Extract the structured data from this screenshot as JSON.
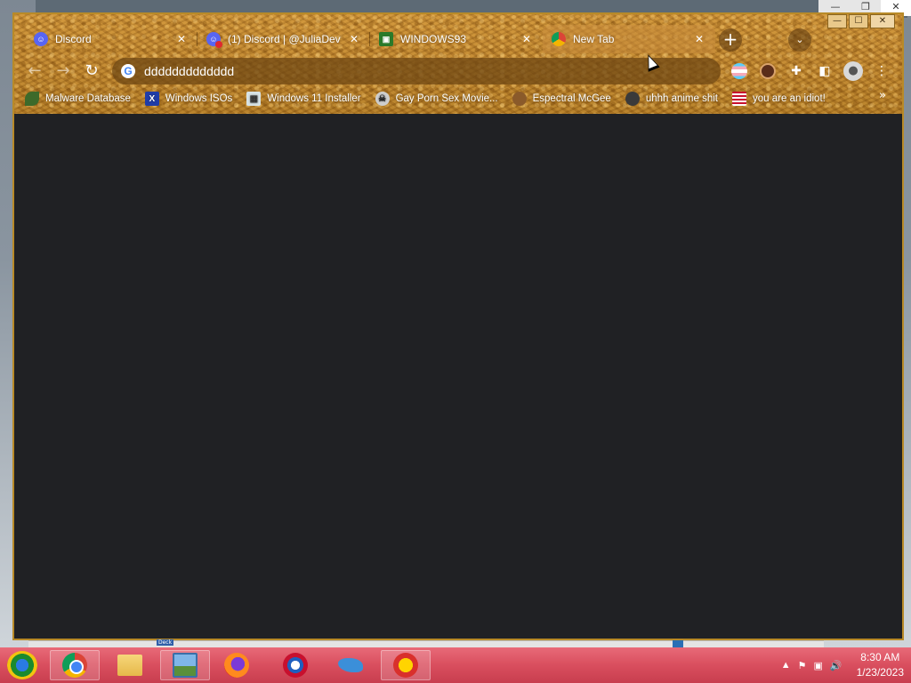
{
  "browser": {
    "tabs": [
      {
        "title": "Discord",
        "favicon": "discord-icon",
        "active": false
      },
      {
        "title": "(1) Discord | @JuliaDev",
        "favicon": "discord-notification-icon",
        "active": false
      },
      {
        "title": "WINDOWS93",
        "favicon": "windows93-icon",
        "active": false
      },
      {
        "title": "New Tab",
        "favicon": "chrome-icon",
        "active": true
      }
    ],
    "tab_close_glyph": "✕",
    "new_tab_glyph": "+",
    "tab_search_glyph": "⌄",
    "address_bar": {
      "value": "ddddddddddddd",
      "engine_icon": "google-icon",
      "engine_glyph": "G"
    },
    "nav": {
      "back": "←",
      "forward": "→",
      "reload": "↻"
    },
    "bookmarks": [
      {
        "label": "Malware Database",
        "icon": "leaf-icon",
        "glyph": ""
      },
      {
        "label": "Windows ISOs",
        "icon": "x-icon",
        "glyph": "X"
      },
      {
        "label": "Windows 11 Installer",
        "icon": "windows-installer-icon",
        "glyph": "▦"
      },
      {
        "label": "Gay Porn Sex Movie...",
        "icon": "skull-icon",
        "glyph": "☠"
      },
      {
        "label": "Espectral McGee",
        "icon": "face-icon",
        "glyph": ""
      },
      {
        "label": "uhhh anime shit",
        "icon": "anime-icon",
        "glyph": ""
      },
      {
        "label": "you are an idiot!",
        "icon": "flag-icon",
        "glyph": ""
      }
    ],
    "bookmarks_overflow": "»",
    "window_controls": {
      "minimize": "—",
      "maximize": "☐",
      "close": "✕"
    },
    "theme_color": "#b9802b",
    "content_bg": "#202124"
  },
  "background_window": {
    "controls": {
      "minimize": "—",
      "maximize": "❐",
      "close": "✕"
    }
  },
  "strip": {
    "label": "Deck"
  },
  "taskbar": {
    "color": "#d94e5e",
    "apps": [
      {
        "name": "chrome",
        "open": true
      },
      {
        "name": "file-explorer",
        "open": false
      },
      {
        "name": "photos",
        "open": true
      },
      {
        "name": "firefox",
        "open": false
      },
      {
        "name": "opera",
        "open": false
      },
      {
        "name": "dolphin",
        "open": false
      },
      {
        "name": "pinball",
        "open": true
      }
    ],
    "tray": {
      "show_hidden": "▲",
      "flag": "⚑",
      "network": "▣",
      "volume": "🔊"
    },
    "clock": {
      "time": "8:30 AM",
      "date": "1/23/2023"
    }
  }
}
